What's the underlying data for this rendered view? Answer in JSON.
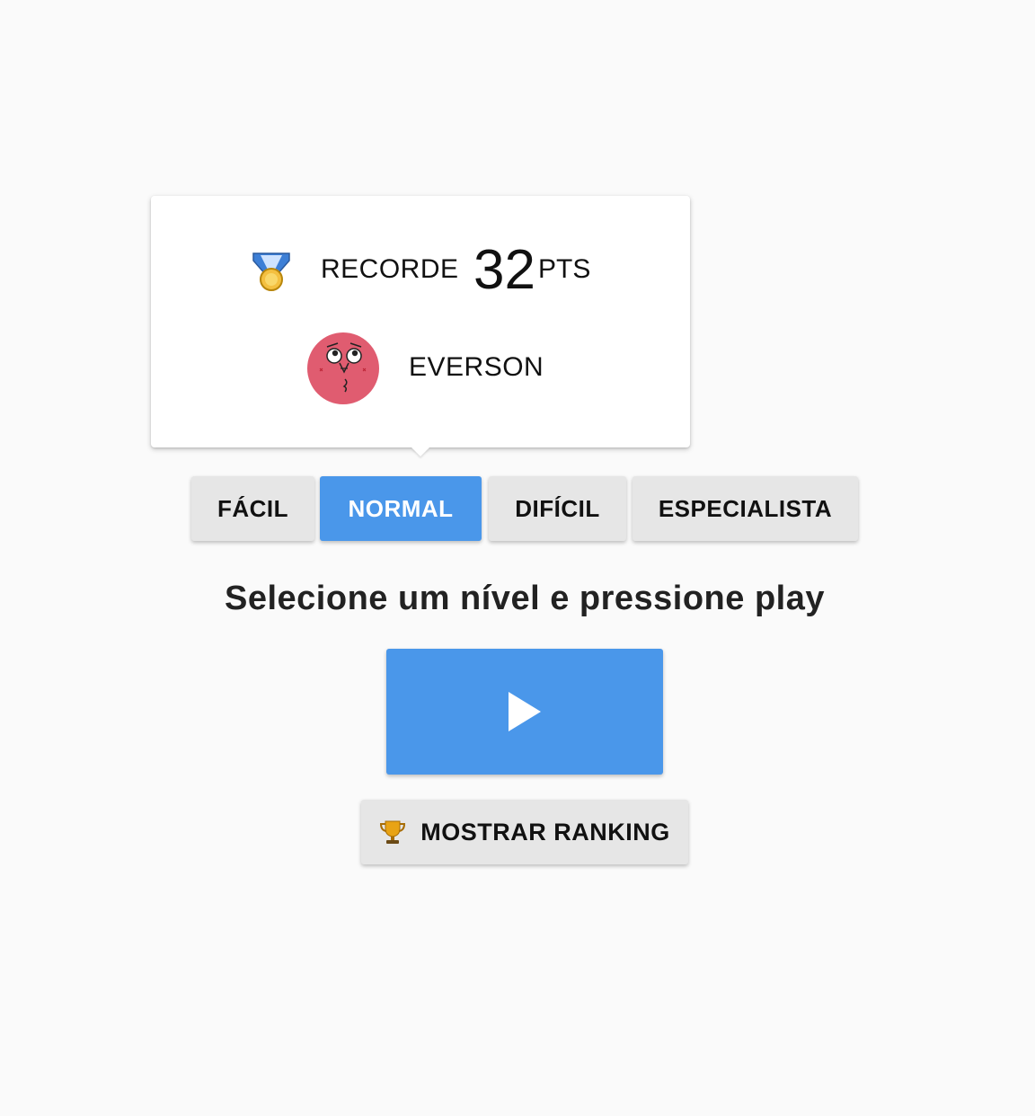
{
  "record": {
    "label": "RECORDE",
    "score": "32",
    "unit": "PTS",
    "player_name": "EVERSON",
    "icons": {
      "medal": "medal-icon",
      "avatar": "avatar-face"
    }
  },
  "levels": [
    {
      "label": "FÁCIL",
      "active": false
    },
    {
      "label": "NORMAL",
      "active": true
    },
    {
      "label": "DIFÍCIL",
      "active": false
    },
    {
      "label": "ESPECIALISTA",
      "active": false
    }
  ],
  "instruction": "Selecione um nível e pressione play",
  "play": {
    "icon": "play-icon"
  },
  "ranking": {
    "label": "MOSTRAR RANKING",
    "icon": "trophy-icon"
  },
  "colors": {
    "accent": "#4a97ea",
    "button_bg": "#e6e6e6",
    "page_bg": "#fafafa",
    "avatar": "#e05c70"
  }
}
